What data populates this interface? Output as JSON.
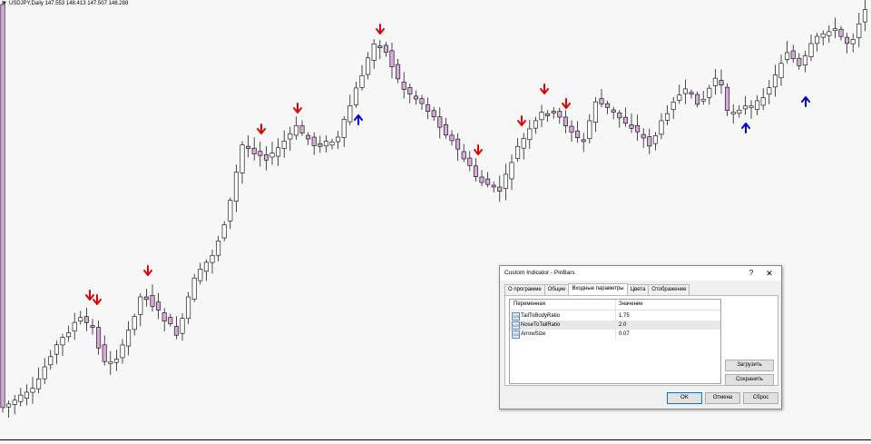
{
  "chart": {
    "symbol_info": "USDJPY,Daily  147.553 148.413 147.507 148.288",
    "colors": {
      "bull_body": "#ffffff",
      "bear_body": "#d8a8dc",
      "outline": "#000000",
      "arrow_down": "#e00000",
      "arrow_up": "#0000cc",
      "background": "#f7f7f7"
    }
  },
  "dialog": {
    "title": "Custom Indicator - PinBars",
    "help_label": "?",
    "close_label": "✕",
    "tabs": [
      "О программе",
      "Общие",
      "Входные параметры",
      "Цвета",
      "Отображение"
    ],
    "active_tab": 2,
    "columns": {
      "variable": "Переменная",
      "value": "Значение"
    },
    "params": [
      {
        "icon": "123",
        "name": "TailToBodyRatio",
        "value": "1.75"
      },
      {
        "icon": "123",
        "name": "NoseToTailRatio",
        "value": "2.0"
      },
      {
        "icon": "123",
        "name": "ArrowSize",
        "value": "0.07"
      }
    ],
    "load_button": "Загрузить",
    "save_button": "Сохранить",
    "ok_button": "OK",
    "cancel_button": "Отмена",
    "reset_button": "Сброс"
  }
}
